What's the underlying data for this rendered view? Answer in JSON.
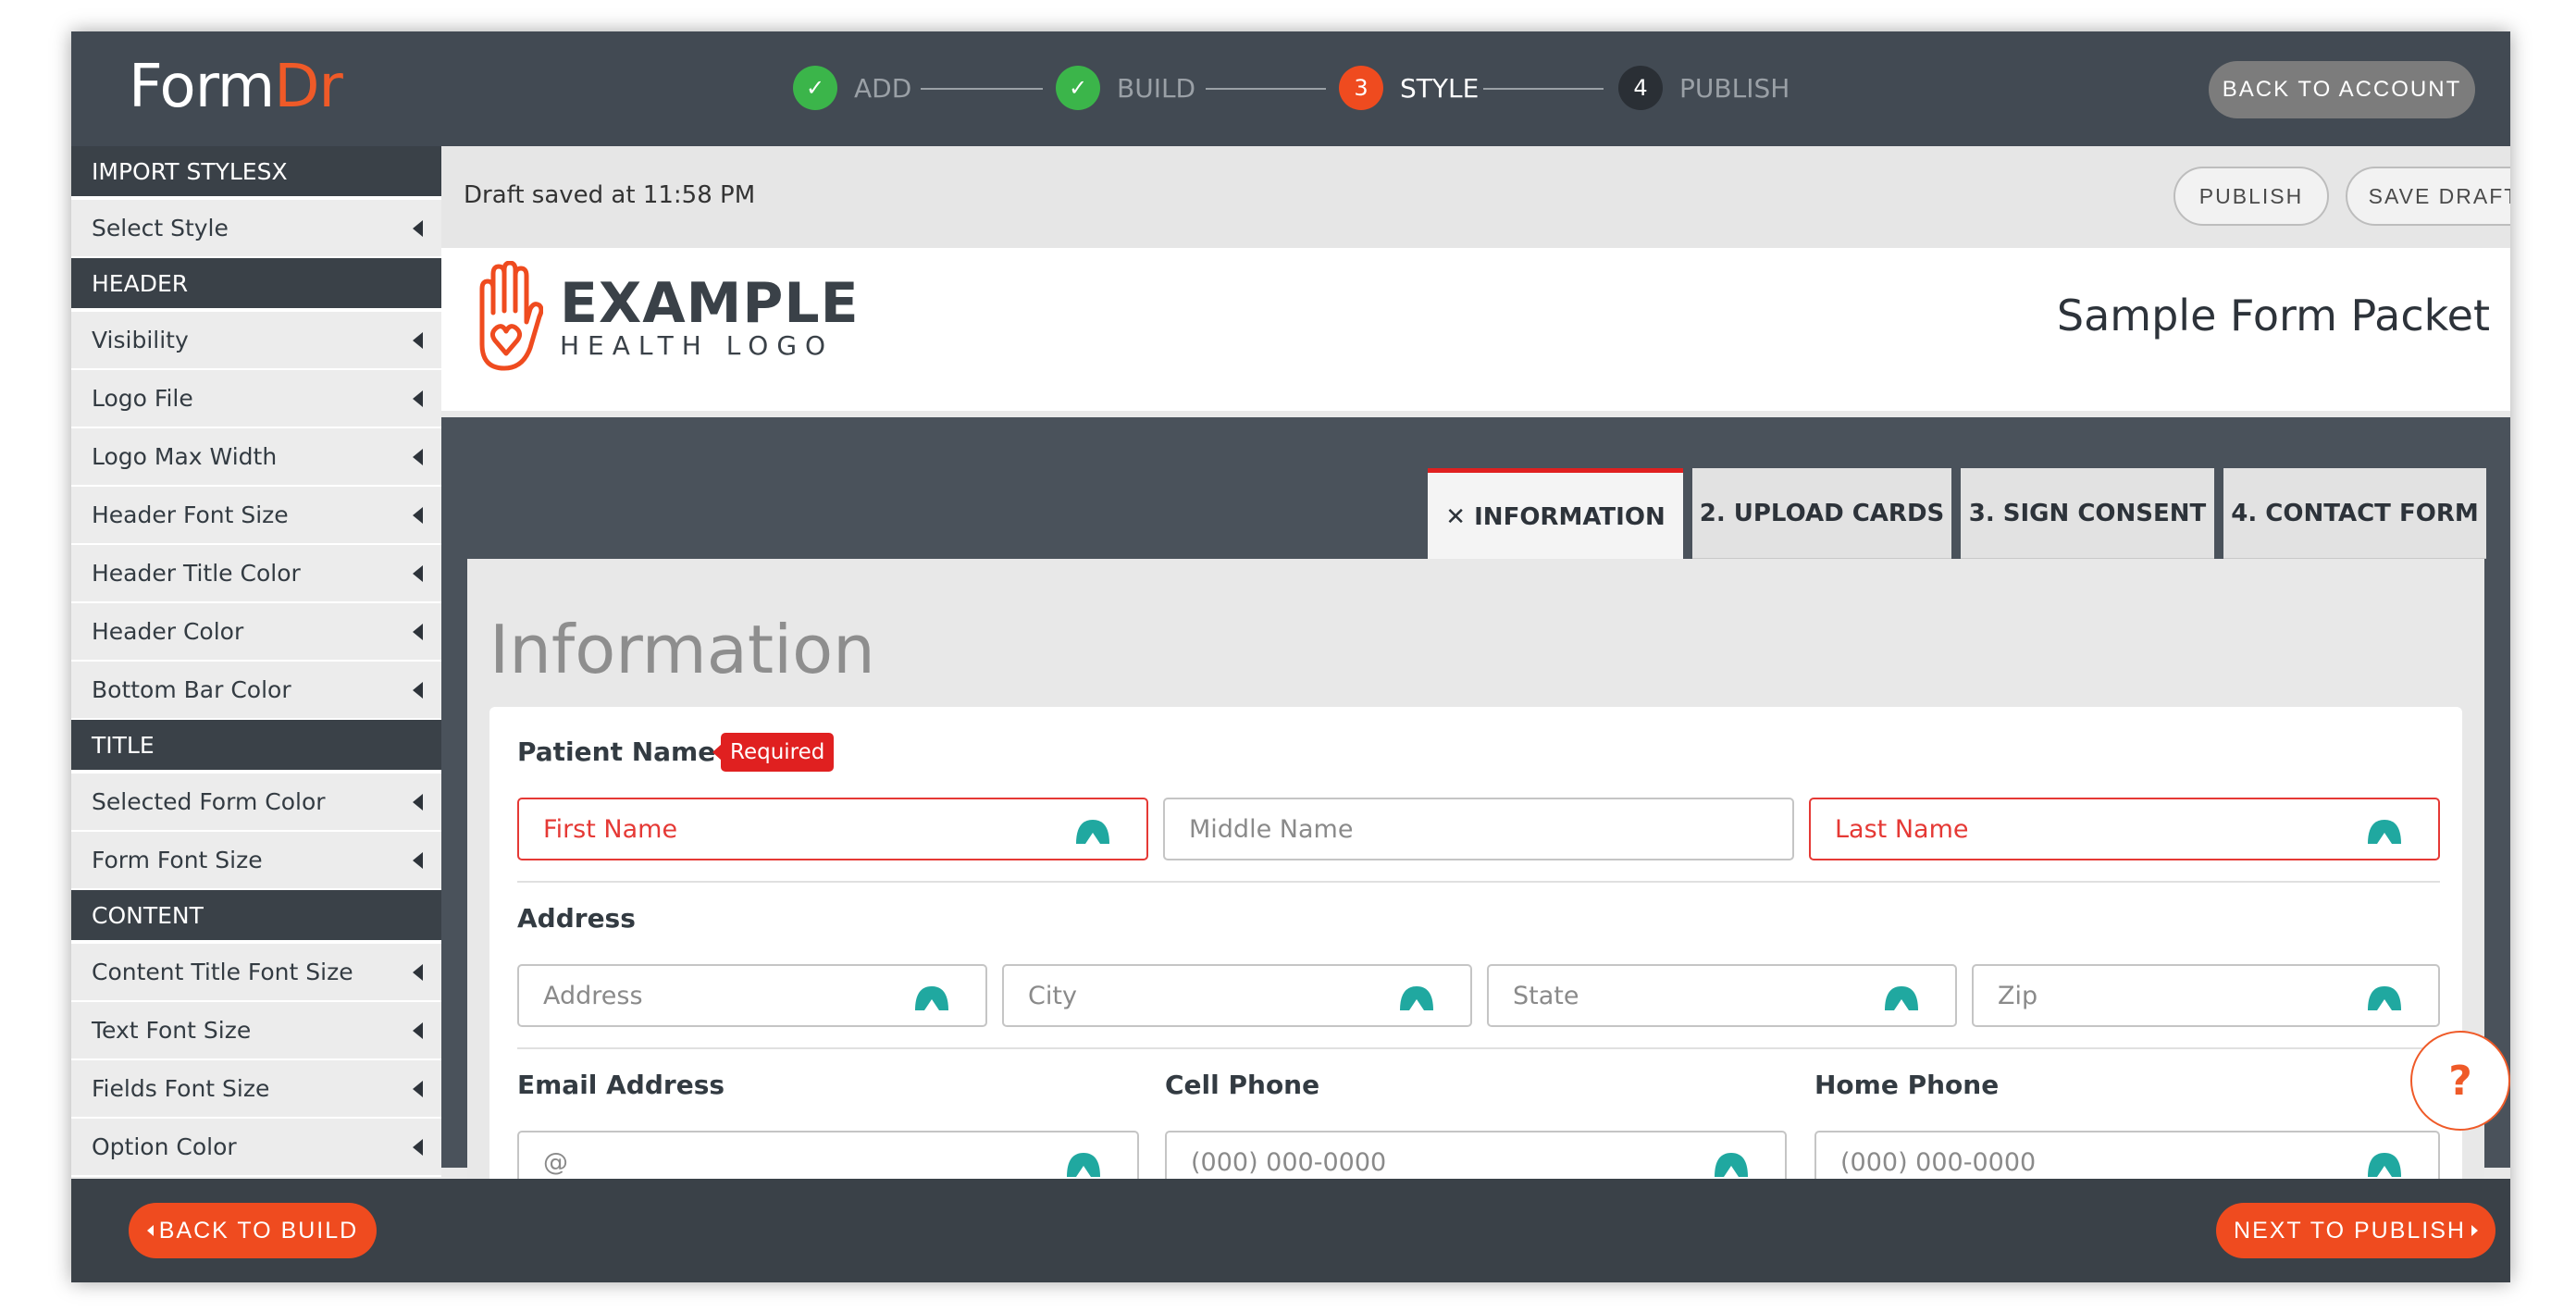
{
  "app": {
    "logo_part1": "Form",
    "logo_part2": "Dr",
    "back_to_account": "BACK TO ACCOUNT"
  },
  "steps": [
    {
      "number": "✓",
      "label": "ADD",
      "state": "done"
    },
    {
      "number": "✓",
      "label": "BUILD",
      "state": "done"
    },
    {
      "number": "3",
      "label": "STYLE",
      "state": "active"
    },
    {
      "number": "4",
      "label": "PUBLISH",
      "state": "pending"
    }
  ],
  "sidebar": {
    "sections": [
      {
        "title": "IMPORT STYLESX",
        "items": [
          "Select Style"
        ]
      },
      {
        "title": "HEADER",
        "items": [
          "Visibility",
          "Logo File",
          "Logo Max Width",
          "Header Font Size",
          "Header Title Color",
          "Header Color",
          "Bottom Bar Color"
        ]
      },
      {
        "title": "TITLE",
        "items": [
          "Selected Form Color",
          "Form Font Size"
        ]
      },
      {
        "title": "CONTENT",
        "items": [
          "Content Title Font Size",
          "Text Font Size",
          "Fields Font Size",
          "Option Color"
        ]
      }
    ]
  },
  "draft": {
    "status": "Draft saved at 11:58 PM",
    "publish": "PUBLISH",
    "save_draft": "SAVE DRAFT"
  },
  "form_header": {
    "logo_line1": "EXAMPLE",
    "logo_line2": "HEALTH LOGO",
    "title": "Sample Form Packet"
  },
  "tabs": [
    {
      "label": "✕  INFORMATION",
      "active": true
    },
    {
      "label": "2. UPLOAD CARDS",
      "active": false
    },
    {
      "label": "3. SIGN CONSENT",
      "active": false
    },
    {
      "label": "4. CONTACT FORM",
      "active": false
    }
  ],
  "panel": {
    "title": "Information",
    "patient_name_label": "Patient Name",
    "required_marker": "*",
    "required_badge": "Required",
    "first_name": "First Name",
    "middle_name": "Middle Name",
    "last_name": "Last Name",
    "address_label": "Address",
    "address": "Address",
    "city": "City",
    "state": "State",
    "zip": "Zip",
    "email_label": "Email Address",
    "email_placeholder": "@",
    "cell_label": "Cell Phone",
    "cell_placeholder": "(000) 000-0000",
    "home_label": "Home Phone",
    "home_placeholder": "(000) 000-0000"
  },
  "help": {
    "glyph": "?"
  },
  "footer": {
    "back_to_build": "BACK TO BUILD",
    "next_to_publish": "NEXT TO PUBLISH"
  },
  "colors": {
    "accent": "#ef4b1f",
    "done_green": "#3bb54a",
    "dark": "#424a53",
    "error": "#e53935",
    "field_icon": "#20a8a0"
  }
}
